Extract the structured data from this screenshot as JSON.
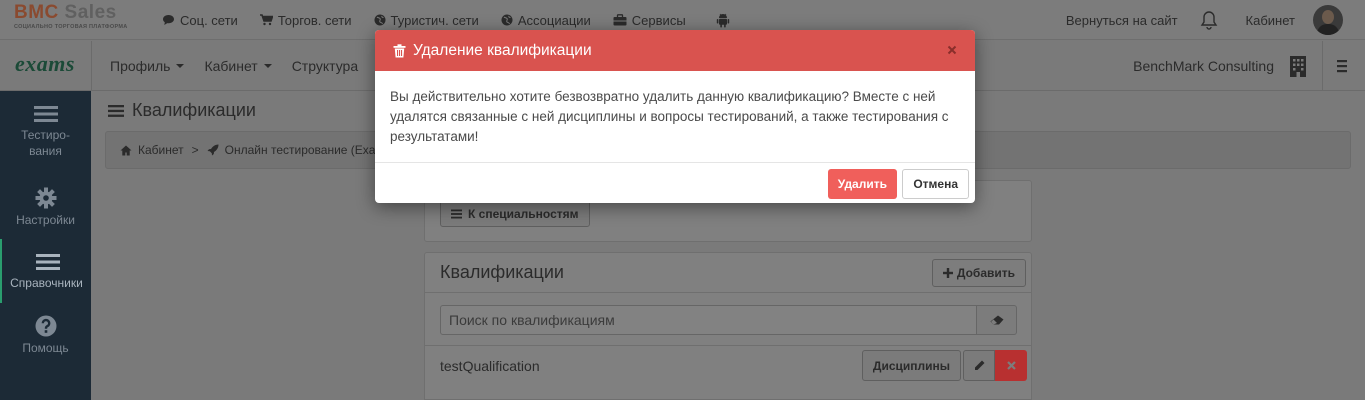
{
  "topbar": {
    "logo_text_a": "BMC",
    "logo_text_b": " Sales",
    "logo_tagline": "СОЦИАЛЬНО ТОРГОВАЯ ПЛАТФОРМА",
    "nav": [
      {
        "label": "Соц. сети",
        "icon": "comment-icon"
      },
      {
        "label": "Торгов. сети",
        "icon": "cart-icon"
      },
      {
        "label": "Туристич. сети",
        "icon": "globe-icon"
      },
      {
        "label": "Ассоциации",
        "icon": "globe-icon"
      },
      {
        "label": "Сервисы",
        "icon": "briefcase-icon"
      },
      {
        "label": "",
        "icon": "android-icon"
      }
    ],
    "back_to_site": "Вернуться на сайт",
    "cabinet": "Кабинет"
  },
  "secbar": {
    "logo": "exams",
    "nav": [
      {
        "label": "Профиль",
        "has_caret": true
      },
      {
        "label": "Кабинет",
        "has_caret": true
      },
      {
        "label": "Структура",
        "has_caret": false
      }
    ],
    "company": "BenchMark Consulting"
  },
  "sidebar": {
    "items": [
      {
        "label_line1": "Тестиро-",
        "label_line2": "вания",
        "icon": "list-icon",
        "active": false
      },
      {
        "label_line1": "Настройки",
        "label_line2": "",
        "icon": "gear-icon",
        "active": false
      },
      {
        "label_line1": "Справочники",
        "label_line2": "",
        "icon": "list-icon",
        "active": true
      },
      {
        "label_line1": "Помощь",
        "label_line2": "",
        "icon": "question-icon",
        "active": false
      }
    ]
  },
  "content": {
    "page_title": "Квалификации",
    "breadcrumb": [
      "Кабинет",
      "Онлайн тестирование (Exam"
    ],
    "back_button": "К специальностям",
    "panel_title": "Квалификации",
    "add_button": "Добавить",
    "search_placeholder": "Поиск по квалификациям",
    "rows": [
      {
        "name": "testQualification",
        "disciplines_button": "Дисциплины"
      }
    ]
  },
  "modal": {
    "title": "Удаление квалификации",
    "body": "Вы действительно хотите безвозвратно удалить данную квалификацию? Вместе с ней удалятся связанные с ней дисциплины и вопросы тестирований, а также тестирования с результатами!",
    "delete_button": "Удалить",
    "cancel_button": "Отмена"
  },
  "colors": {
    "modal_header": "#d9534f",
    "delete_button": "#f05f5b",
    "sidebar_bg": "#1c2a36",
    "overlay": "#7a7a7a"
  }
}
